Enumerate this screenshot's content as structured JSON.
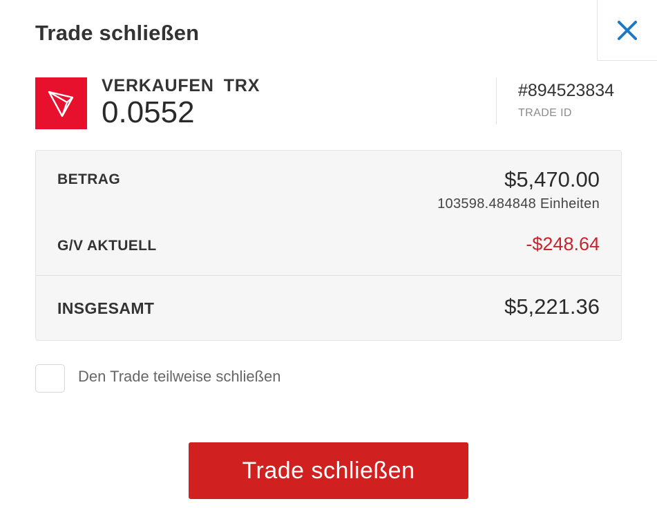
{
  "dialog": {
    "title": "Trade schließen",
    "close_icon": "close-x-icon",
    "accent_color": "#1b78c2"
  },
  "asset": {
    "logo_icon": "tron-logo-icon",
    "logo_color": "#e8112d",
    "side": "VERKAUFEN",
    "symbol": "TRX",
    "rate": "0.0552"
  },
  "trade": {
    "id": "#894523834",
    "id_label": "TRADE ID"
  },
  "summary": {
    "amount_label": "BETRAG",
    "amount_value": "$5,470.00",
    "units": "103598.484848 Einheiten",
    "pl_label": "G/V AKTUELL",
    "pl_value": "-$248.64",
    "pl_color": "#c7252d",
    "total_label": "INSGESAMT",
    "total_value": "$5,221.36"
  },
  "partial_close": {
    "checked": false,
    "label": "Den Trade teilweise schließen"
  },
  "actions": {
    "close_trade_label": "Trade schließen",
    "button_color": "#d0201f"
  }
}
